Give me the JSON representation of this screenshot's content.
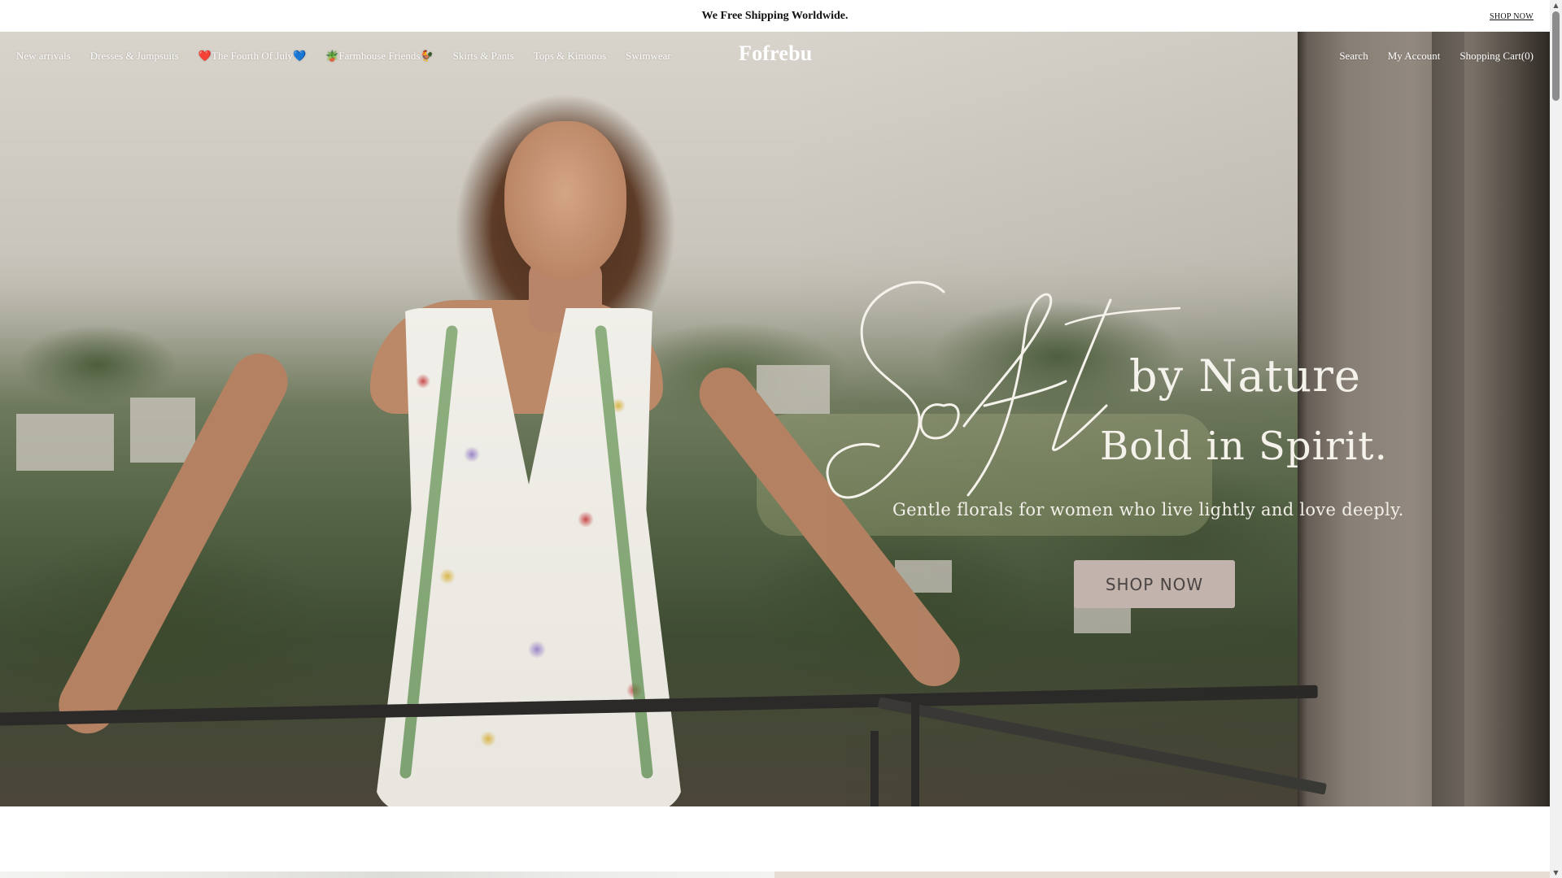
{
  "announcement": {
    "text": "We Free Shipping Worldwide.",
    "link": "SHOP NOW"
  },
  "nav": {
    "left": [
      "New arrivals",
      "Dresses & Jumpsuits",
      "❤️The Fourth Of July💙",
      "🪴Farmhouse Friends🐓",
      "Skirts & Pants",
      "Tops & Kimonos",
      "Swimwear"
    ],
    "logo": "Fofrebu",
    "right": {
      "search": "Search",
      "account": "My Account",
      "cart": "Shopping Cart",
      "cart_count": "(0)"
    }
  },
  "hero": {
    "script_word": "Soft",
    "line1": "by Nature",
    "line2": "Bold in Spirit.",
    "tagline": "Gentle florals for women who live lightly and love deeply.",
    "cta": "SHOP NOW",
    "colors": {
      "cta_bg": "#c3b3ad",
      "cta_text": "#4a4443",
      "headline": "#f5f2ec"
    }
  }
}
